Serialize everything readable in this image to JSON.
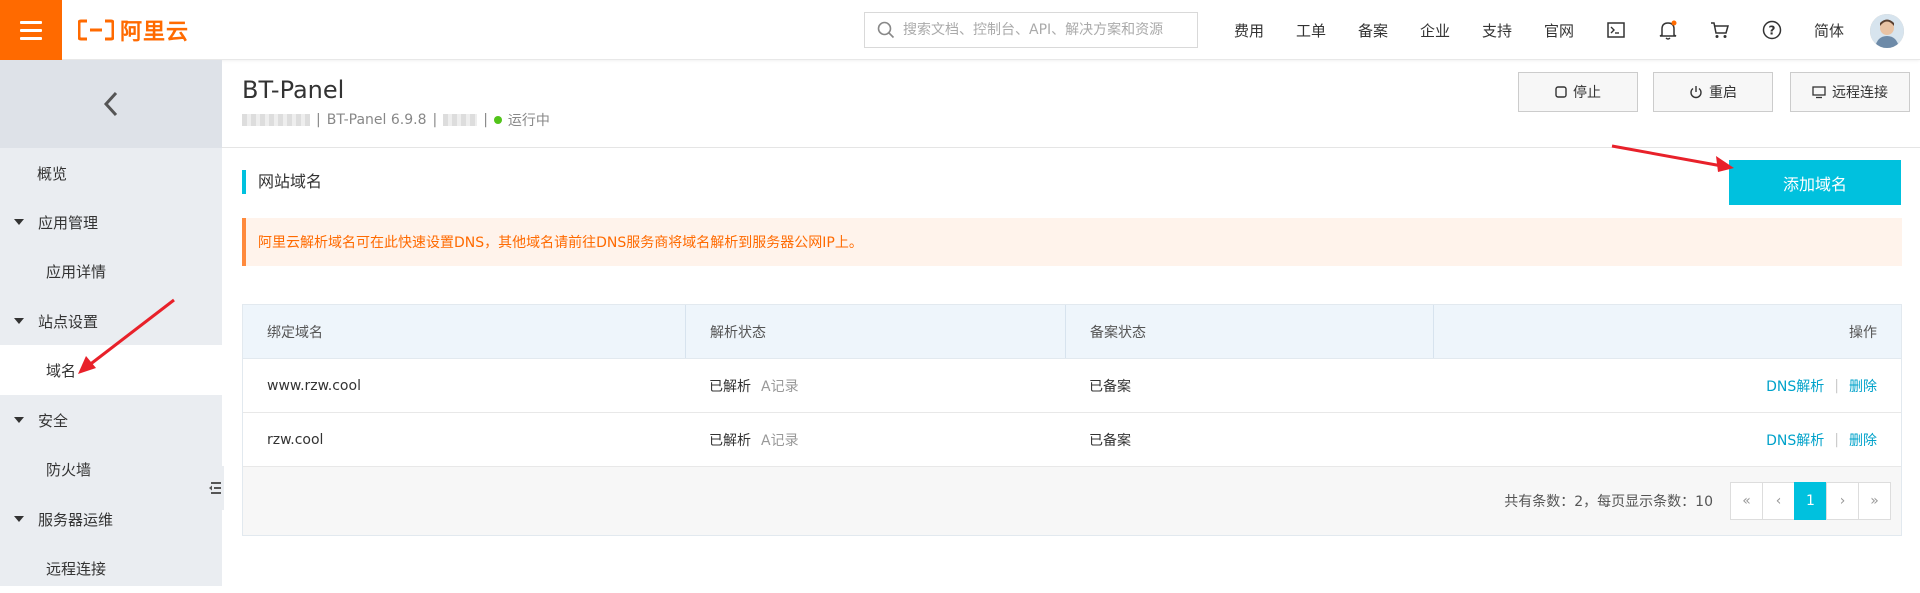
{
  "topbar": {
    "logo_text": "阿里云",
    "search_placeholder": "搜索文档、控制台、API、解决方案和资源",
    "nav": [
      "费用",
      "工单",
      "备案",
      "企业",
      "支持",
      "官网"
    ],
    "lang": "简体",
    "brand_color": "#ff6a00"
  },
  "sidebar": {
    "overview": "概览",
    "groups": [
      {
        "label": "应用管理",
        "items": [
          "应用详情"
        ]
      },
      {
        "label": "站点设置",
        "items": [
          "域名"
        ]
      },
      {
        "label": "安全",
        "items": [
          "防火墙"
        ]
      },
      {
        "label": "服务器运维",
        "items": [
          "远程连接"
        ]
      }
    ],
    "active_item": "域名"
  },
  "header": {
    "title": "BT-Panel",
    "version": "BT-Panel 6.9.8",
    "status": "运行中",
    "buttons": {
      "stop": "停止",
      "restart": "重启",
      "remote": "远程连接"
    }
  },
  "section": {
    "title": "网站域名",
    "add_button": "添加域名",
    "notice": "阿里云解析域名可在此快速设置DNS，其他域名请前往DNS服务商将域名解析到服务器公网IP上。"
  },
  "table": {
    "headers": [
      "绑定域名",
      "解析状态",
      "备案状态",
      "操作"
    ],
    "rows": [
      {
        "domain": "www.rzw.cool",
        "dns_status": "已解析",
        "record": "A记录",
        "icp": "已备案",
        "action_dns": "DNS解析",
        "action_delete": "删除"
      },
      {
        "domain": "rzw.cool",
        "dns_status": "已解析",
        "record": "A记录",
        "icp": "已备案",
        "action_dns": "DNS解析",
        "action_delete": "删除"
      }
    ],
    "footer": "共有条数：2，每页显示条数：10",
    "pager": {
      "first": "«",
      "prev": "‹",
      "current": "1",
      "next": "›",
      "last": "»"
    }
  },
  "colors": {
    "accent": "#00c1de",
    "arrow": "#e8212a",
    "status_green": "#52c41a"
  }
}
